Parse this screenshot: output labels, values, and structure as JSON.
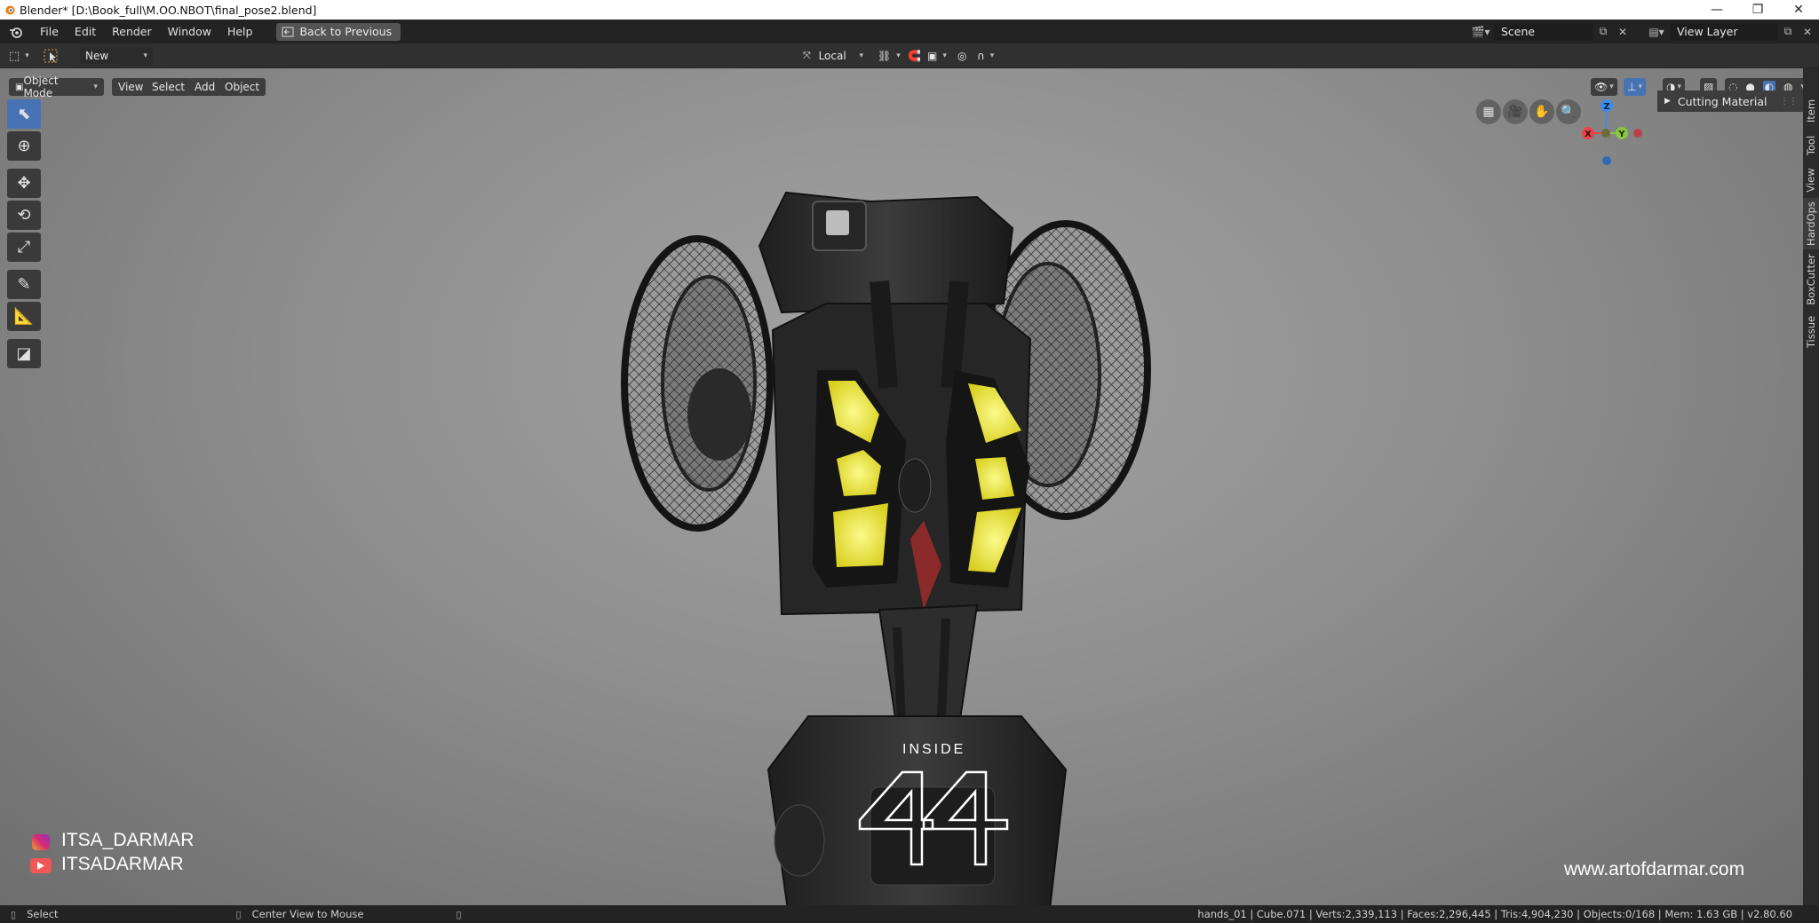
{
  "window": {
    "title": "Blender* [D:\\Book_full\\M.OO.NBOT\\final_pose2.blend]",
    "controls": [
      "—",
      "❐",
      "✕"
    ]
  },
  "menu": {
    "items": [
      "File",
      "Edit",
      "Render",
      "Window",
      "Help"
    ],
    "back_button": "Back to Previous"
  },
  "scene": {
    "label": "Scene",
    "view_layer": "View Layer"
  },
  "tool_header": {
    "new_label": "New",
    "transform_orientation": "Local"
  },
  "viewport_header": {
    "mode": "Object Mode",
    "menus": [
      "View",
      "Select",
      "Add",
      "Object"
    ]
  },
  "gizmo": {
    "z": "Z",
    "y": "Y",
    "x": "X"
  },
  "npanel": {
    "panel_title": "Cutting Material"
  },
  "sidebar_tabs": [
    "Item",
    "Tool",
    "View",
    "HardOps",
    "BoxCutter",
    "Tissue"
  ],
  "overlay": {
    "instagram": "ITSA_DARMAR",
    "youtube": "ITSADARMAR",
    "website": "www.artofdarmar.com",
    "brand_small": "INSIDE"
  },
  "statusbar": {
    "select": "Select",
    "center_view": "Center View to Mouse",
    "stats": "hands_01 | Cube.071 | Verts:2,339,113 | Faces:2,296,445 | Tris:4,904,230 | Objects:0/168 | Mem: 1.63 GB | v2.80.60"
  },
  "colors": {
    "accent": "#4772b3",
    "axis_x": "#e8434f",
    "axis_y": "#8bc63f",
    "axis_z": "#3c8de8",
    "glow": "#f2ef4a"
  }
}
